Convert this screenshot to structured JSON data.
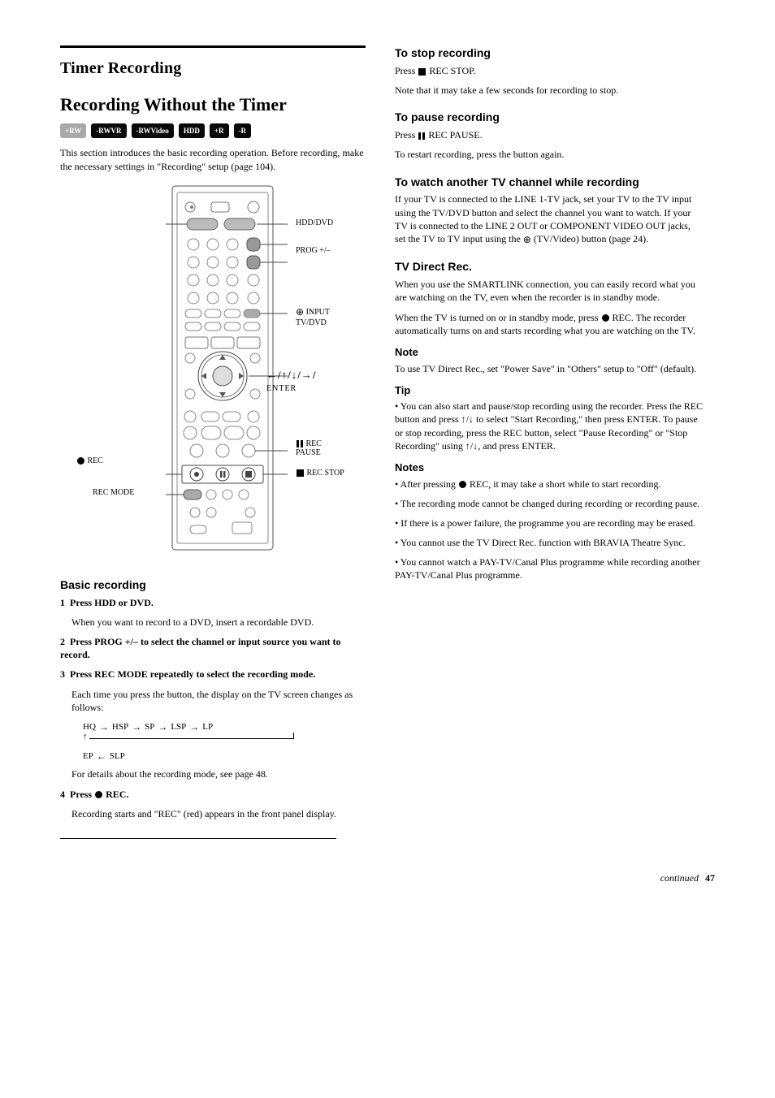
{
  "page": {
    "section_heading": "Timer Recording",
    "title": "Recording Without the Timer",
    "badges": [
      {
        "label": "+RW",
        "bg": "#a8a8a8"
      },
      {
        "label": "-RWVR",
        "bg": "#0a0a0a"
      },
      {
        "label": "-RWVideo",
        "bg": "#0a0a0a"
      },
      {
        "label": "HDD",
        "bg": "#0a0a0a"
      },
      {
        "label": "+R",
        "bg": "#0a0a0a"
      },
      {
        "label": "-R",
        "bg": "#0a0a0a"
      }
    ],
    "intro": "This section introduces the basic recording operation. Before recording, make the necessary settings in \"Recording\" setup (page 104).",
    "remote_labels": {
      "hdd_dvd": "HDD/DVD",
      "input": "INPUT",
      "prog": "PROG +/–",
      "tvdvd": "TV/DVD",
      "arrows_enter": "←/↑/↓/→/\nENTER",
      "rec_pause": "REC\nPAUSE",
      "rec_stop": "REC STOP",
      "rec": "REC",
      "rec_mode": "REC MODE"
    },
    "basic": {
      "h": "Basic recording",
      "steps": [
        {
          "n": "1",
          "body": "Press HDD or DVD.",
          "sub": "When you want to record to a DVD, insert a recordable DVD."
        },
        {
          "n": "2",
          "body": "Press PROG +/– to select the channel or input source you want to record."
        },
        {
          "n": "3",
          "body": "Press REC MODE repeatedly to select the recording mode.",
          "sub": "Each time you press the button, the display on the TV screen changes as follows:"
        },
        {
          "n": "4",
          "body_pre": "Press ",
          "body_post": " REC.",
          "sub": "Recording starts and \"REC\" (red) appears in the front panel display."
        }
      ],
      "flow": [
        "HQ",
        "HSP",
        "SP",
        "LSP",
        "LP"
      ],
      "flow_line2_prefix": "EP",
      "flow_line2_suffix": "SLP",
      "after_flow": "For details about the recording mode, see page 48."
    },
    "right": {
      "stop": {
        "h": "To stop recording",
        "body_pre": "Press ",
        "body_mid": " REC STOP.",
        "body_after": "Note that it may take a few seconds for recording to stop."
      },
      "pause": {
        "h": "To pause recording",
        "body_pre": "Press ",
        "body_mid": " REC PAUSE.",
        "body_after": "To restart recording, press the button again."
      },
      "another": {
        "h": "To watch another TV channel while recording",
        "p1": "If your TV is connected to the LINE 1-TV jack, set your TV to the TV input using the TV/DVD button and select the channel you want to watch. If your TV is connected to the LINE 2 OUT or COMPONENT VIDEO OUT jacks, set the TV to TV input using the ",
        "p1_mid": " (TV/Video) button (page 24).",
        "p1_end": ""
      },
      "tvdirect": {
        "h": "TV Direct Rec.",
        "p1": "When you use the SMARTLINK connection, you can easily record what you are watching on the TV, even when the recorder is in standby mode.",
        "p2_pre": "When the TV is turned on or in standby mode, press ",
        "p2_post": " REC. The recorder automatically turns on and starts recording what you are watching on the TV.",
        "note_label": "Note",
        "note_body": "To use TV Direct Rec., set \"Power Save\" in \"Others\" setup to \"Off\" (default)."
      },
      "tip_label": "Tip",
      "tip_body": "• You can also start and pause/stop recording using the recorder. Press the REC button and press ↑/↓ to select \"Start Recording,\" then press ENTER. To pause or stop recording, press the REC button, select \"Pause Recording\" or \"Stop Recording\" using ↑/↓, and press ENTER.",
      "notes_label": "Notes",
      "notes": [
        "After pressing ● REC, it may take a short while to start recording.",
        "The recording mode cannot be changed during recording or recording pause.",
        "If there is a power failure, the programme you are recording may be erased.",
        "You cannot use the TV Direct Rec. function with BRAVIA Theatre Sync.",
        "You cannot watch a PAY-TV/Canal Plus programme while recording another PAY-TV/Canal Plus programme."
      ]
    }
  },
  "footer": {
    "label": "continued",
    "page": "47"
  }
}
